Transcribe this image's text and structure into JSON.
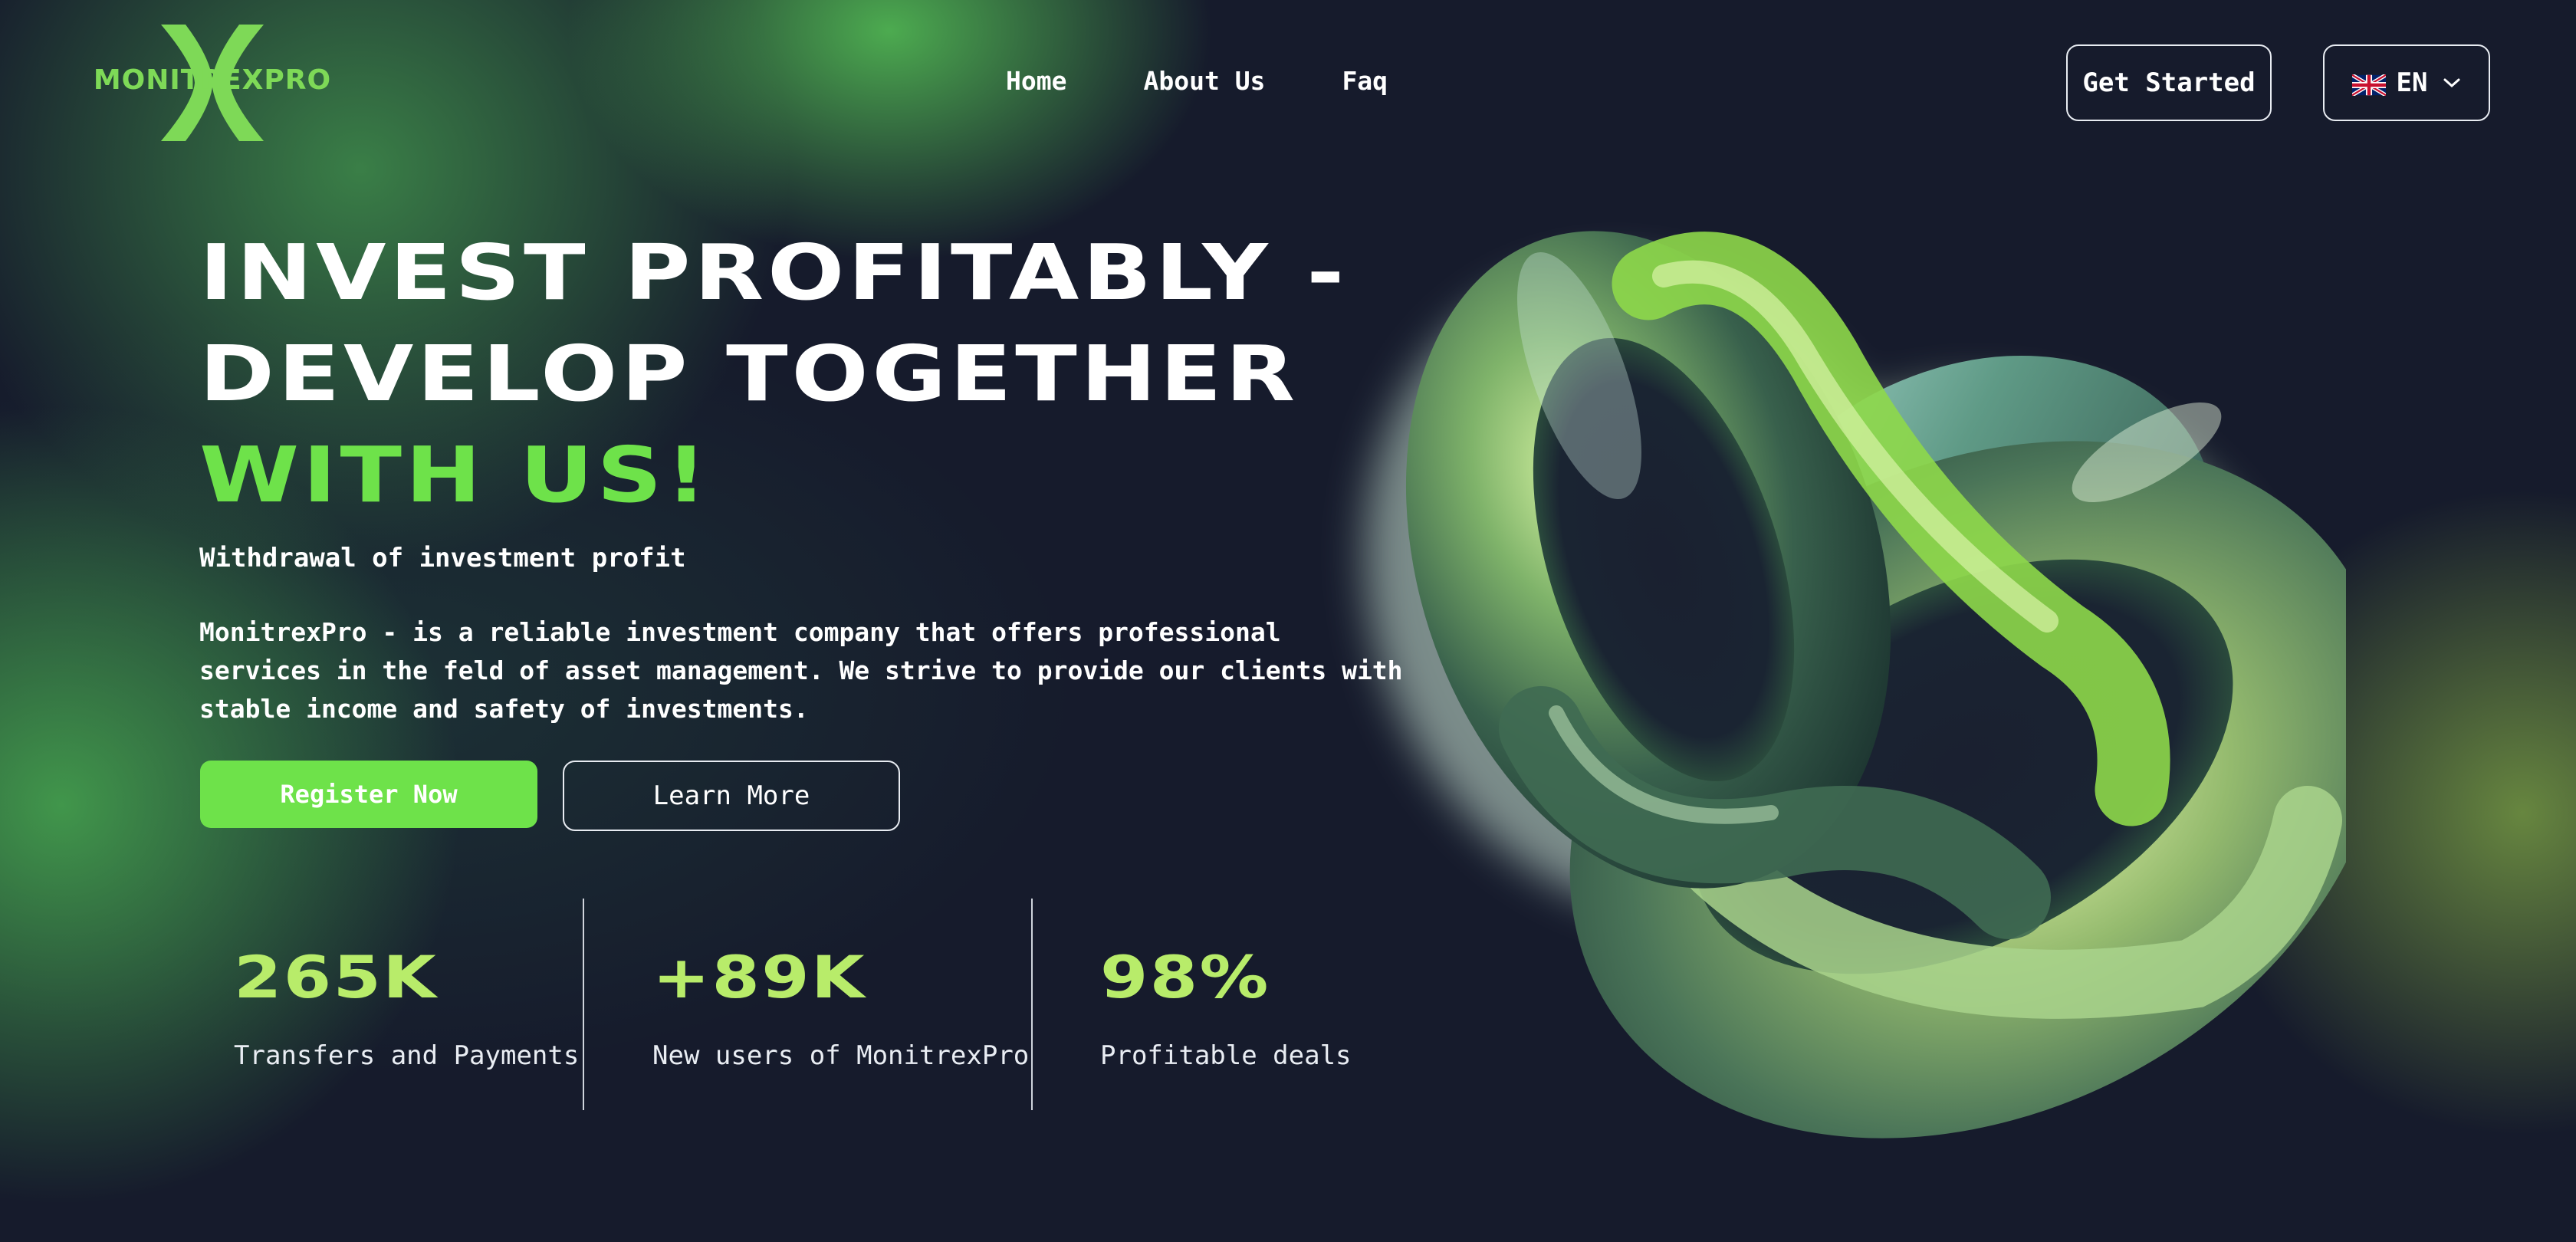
{
  "brand": {
    "name": "MONITREXPRO",
    "accent": "#6ee24a",
    "logo_color": "#7ed957"
  },
  "nav": {
    "items": [
      {
        "label": "Home"
      },
      {
        "label": "About Us"
      },
      {
        "label": "Faq"
      }
    ]
  },
  "header": {
    "get_started_label": "Get Started",
    "language": {
      "code": "EN",
      "flag_icon": "uk-flag-icon",
      "chevron_icon": "chevron-down-icon"
    }
  },
  "hero": {
    "title_line_1": "INVEST PROFITABLY -",
    "title_line_2": "DEVELOP TOGETHER",
    "title_line_3": "WITH US!",
    "subtitle": "Withdrawal of investment profit",
    "description": "MonitrexPro - is a reliable investment company that offers professional services in the feld of asset management. We strive to provide our clients with stable income and safety of investments.",
    "register_label": "Register Now",
    "learn_more_label": "Learn More"
  },
  "stats": [
    {
      "value": "265K",
      "label": "Transfers and Payments"
    },
    {
      "value": "+89K",
      "label": "New users of MonitrexPro"
    },
    {
      "value": "98%",
      "label": "Profitable deals"
    }
  ],
  "colors": {
    "background": "#161b2c",
    "stat_value": "#b8ec6a",
    "button_border": "#e8ecf2"
  }
}
